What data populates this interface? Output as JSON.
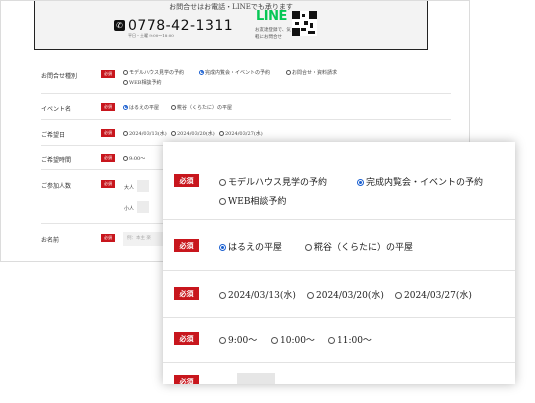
{
  "contact": {
    "lead": "お問合せはお電話・LINEでも承ります",
    "phone_icon": "phone-icon",
    "phone": "0778-42-1311",
    "hours": "平日・土曜 9:00～18:00",
    "line_logo": "LINE",
    "line_note": "お友達登録で、気軽にお問合せ",
    "qr_icon": "qr-code-icon"
  },
  "form": {
    "required_label": "必須",
    "rows": {
      "inquiry_type": {
        "label": "お問合せ種別",
        "options": [
          "モデルハウス見学の予約",
          "完成内覧会・イベントの予約",
          "お問合せ・資料請求",
          "WEB相談予約"
        ],
        "selected": "完成内覧会・イベントの予約"
      },
      "event": {
        "label": "イベント名",
        "options": [
          "はるえの平屋",
          "糀谷（くらたに）の平屋"
        ],
        "selected": "はるえの平屋"
      },
      "date": {
        "label": "ご希望日",
        "options": [
          "2024/03/13(水)",
          "2024/03/20(水)",
          "2024/03/27(水)"
        ]
      },
      "time": {
        "label": "ご希望時間",
        "options": [
          "9:00～",
          "10:00～",
          "11:00～"
        ]
      },
      "participants": {
        "label": "ご参加人数",
        "adult": "大人",
        "child": "小人"
      },
      "name": {
        "label": "お名前",
        "placeholder": "例：本主 楽"
      }
    }
  }
}
